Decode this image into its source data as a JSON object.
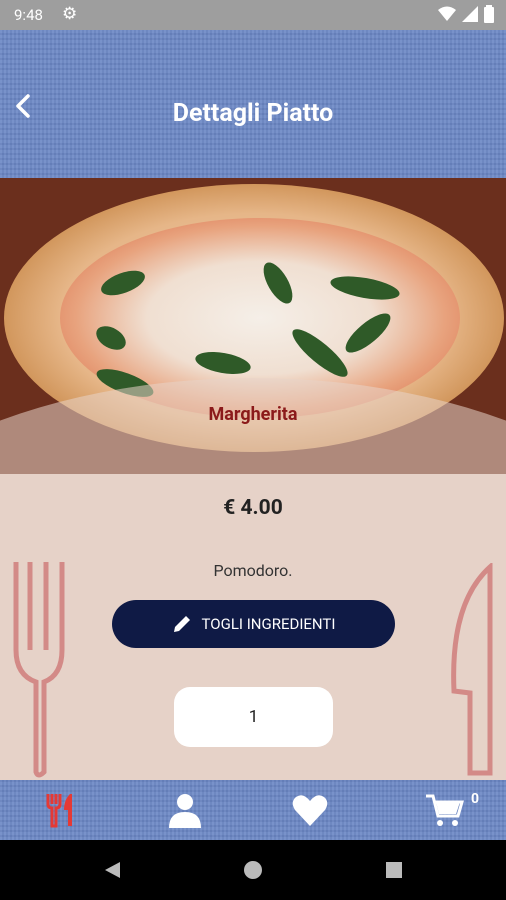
{
  "status_bar": {
    "time": "9:48"
  },
  "header": {
    "title": "Dettagli Piatto"
  },
  "dish": {
    "name": "Margherita",
    "price": "€ 4.00",
    "ingredients": "Pomodoro.",
    "remove_button_label": "TOGLI INGREDIENTI",
    "quantity": "1"
  },
  "bottom_nav": {
    "cart_count": "0"
  },
  "colors": {
    "accent": "#6a86c4",
    "button": "#0f1a45",
    "dish_name": "#8b1a1a",
    "active_nav": "#e53935",
    "background": "#e6d2c8"
  }
}
